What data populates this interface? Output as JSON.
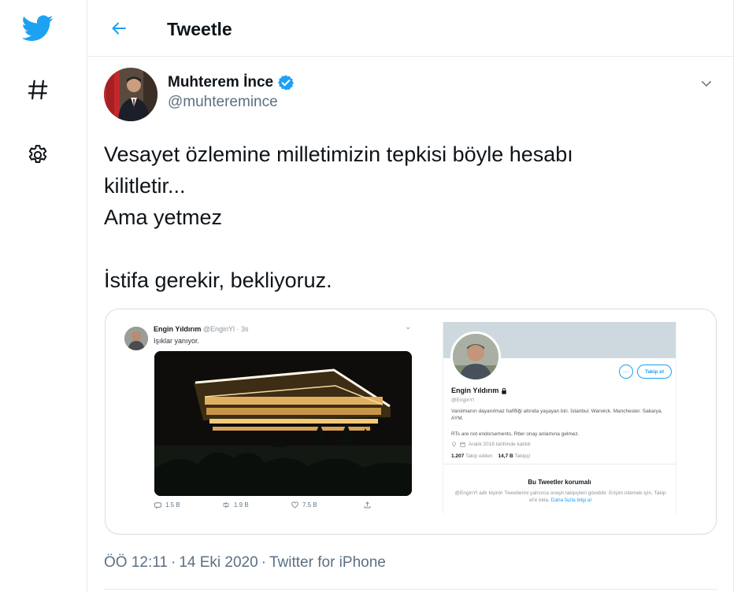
{
  "colors": {
    "accent": "#1da1f2",
    "text_primary": "#0f1419",
    "text_secondary": "#5b7083",
    "verified": "#1da1f2",
    "divider": "#eaeaea"
  },
  "nav": {
    "items": [
      {
        "icon": "twitter-bird-icon"
      },
      {
        "icon": "hashtag-icon"
      },
      {
        "icon": "gear-icon"
      }
    ]
  },
  "header": {
    "back_icon": "arrow-left-icon",
    "title": "Tweetle"
  },
  "tweet": {
    "author": {
      "name": "Muhterem İnce",
      "handle": "@muhteremince",
      "verified": true
    },
    "text_lines": [
      "Vesayet özlemine milletimizin tepkisi böyle hesabı",
      "kilitletir...",
      "Ama yetmez",
      "İstifa gerekir, bekliyoruz."
    ],
    "timestamp": {
      "time": "ÖÖ 12:11",
      "date": "14 Eki 2020",
      "source": "Twitter for iPhone"
    }
  },
  "media": {
    "embedded_tweet": {
      "name": "Engin Yıldırım",
      "meta": "@EnginYl · 3s",
      "text": "Işıklar yanıyor.",
      "actions": {
        "reply": "1.5 B",
        "retweet": "1.9 B",
        "like": "7.5 B"
      }
    },
    "embedded_profile": {
      "name": "Engin Yıldırım",
      "handle": "@EnginYl",
      "follow_label": "Takip et",
      "bio": "Varolmanın dayanılmaz hafifliği altında yaşayan biri. İstanbul. Warwick. Manchester. Sakarya. AYM.",
      "rts_note": "RTs are not endorsements. Rtler onay anlamına gelmez.",
      "joined": "Aralık 2018 tarihinde katıldı",
      "following_count": "1.207",
      "following_label": "Takip edilen",
      "followers_count": "14,7 B",
      "followers_label": "Takipçi",
      "protected_title": "Bu Tweetler korumalı",
      "protected_text": "@EnginYl adlı kişinin Tweetlerini yalnızca onaylı takipçileri görebilir. Erişim istemek için, Takip et'e tıkla.",
      "learn_more": "Daha fazla bilgi al"
    }
  }
}
